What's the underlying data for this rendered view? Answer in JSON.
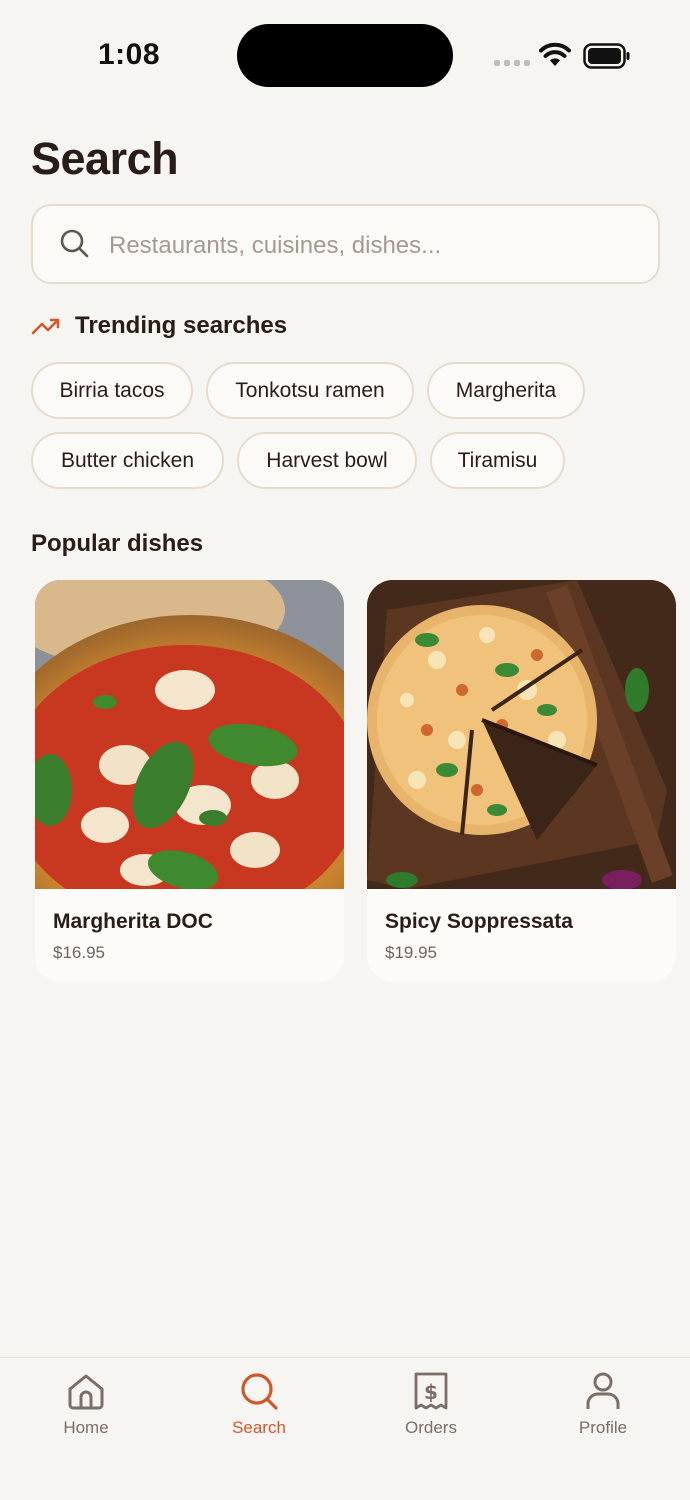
{
  "status": {
    "time": "1:08"
  },
  "page": {
    "title": "Search"
  },
  "search": {
    "placeholder": "Restaurants, cuisines, dishes...",
    "value": ""
  },
  "trending": {
    "title": "Trending searches",
    "chips": [
      "Birria tacos",
      "Tonkotsu ramen",
      "Margherita",
      "Butter chicken",
      "Harvest bowl",
      "Tiramisu"
    ]
  },
  "popular": {
    "title": "Popular dishes",
    "dishes": [
      {
        "name": "Margherita DOC",
        "price": "$16.95"
      },
      {
        "name": "Spicy Soppressata",
        "price": "$19.95"
      }
    ]
  },
  "tabs": [
    {
      "label": "Home",
      "icon": "home-icon",
      "active": false
    },
    {
      "label": "Search",
      "icon": "search-icon",
      "active": true
    },
    {
      "label": "Orders",
      "icon": "receipt-icon",
      "active": false
    },
    {
      "label": "Profile",
      "icon": "person-icon",
      "active": false
    }
  ],
  "colors": {
    "accent": "#d0572b",
    "background": "#f7f5f1",
    "text": "#2a1d17",
    "border": "#e6dccd"
  }
}
